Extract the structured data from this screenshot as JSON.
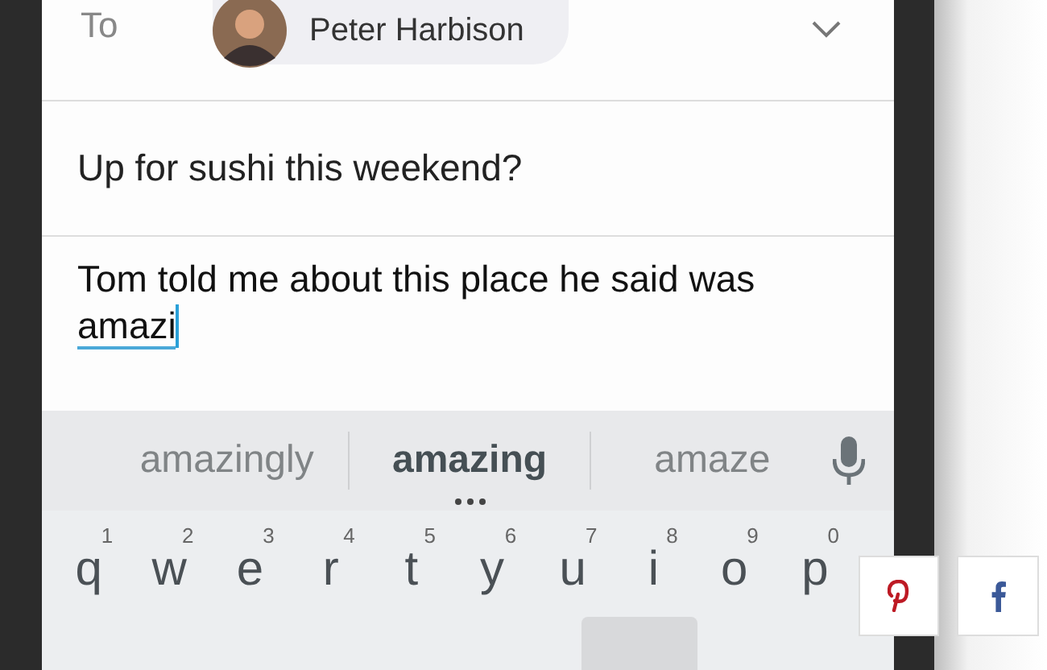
{
  "compose": {
    "to_label": "To",
    "recipient": {
      "name": "Peter Harbison"
    },
    "subject": "Up for sushi this weekend?",
    "body": "Tom told me about this place he said was ",
    "composing_word": "amazi"
  },
  "keyboard": {
    "suggestions": [
      {
        "text": "amazingly",
        "selected": false
      },
      {
        "text": "amazing",
        "selected": true
      },
      {
        "text": "amaze",
        "selected": false
      }
    ],
    "keys": [
      {
        "letter": "q",
        "hint": "1"
      },
      {
        "letter": "w",
        "hint": "2"
      },
      {
        "letter": "e",
        "hint": "3"
      },
      {
        "letter": "r",
        "hint": "4"
      },
      {
        "letter": "t",
        "hint": "5"
      },
      {
        "letter": "y",
        "hint": "6"
      },
      {
        "letter": "u",
        "hint": "7"
      },
      {
        "letter": "i",
        "hint": "8"
      },
      {
        "letter": "o",
        "hint": "9"
      },
      {
        "letter": "p",
        "hint": "0"
      }
    ]
  },
  "share_buttons": [
    {
      "kind": "pinterest"
    },
    {
      "kind": "facebook"
    }
  ]
}
